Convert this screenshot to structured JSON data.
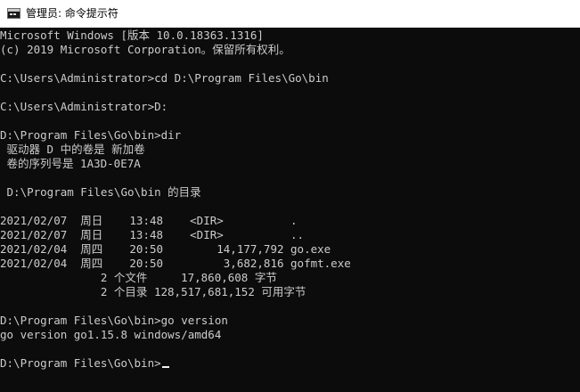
{
  "window": {
    "title": "管理员: 命令提示符",
    "icon": "cmd-console-icon"
  },
  "colors": {
    "background": "#0c0c0c",
    "text": "#cccccc",
    "titlebar": "#ffffff"
  },
  "console": {
    "lines": [
      "Microsoft Windows [版本 10.0.18363.1316]",
      "(c) 2019 Microsoft Corporation。保留所有权利。",
      "C:\\Users\\Administrator>cd D:\\Program Files\\Go\\bin",
      "C:\\Users\\Administrator>D:",
      "D:\\Program Files\\Go\\bin>dir",
      " 驱动器 D 中的卷是 新加卷",
      " 卷的序列号是 1A3D-0E7A",
      " D:\\Program Files\\Go\\bin 的目录",
      "2021/02/07  周日    13:48    <DIR>          .",
      "2021/02/07  周日    13:48    <DIR>          ..",
      "2021/02/04  周四    20:50        14,177,792 go.exe",
      "2021/02/04  周四    20:50         3,682,816 gofmt.exe",
      "               2 个文件     17,860,608 字节",
      "               2 个目录 128,517,681,152 可用字节",
      "D:\\Program Files\\Go\\bin>go version",
      "go version go1.15.8 windows/amd64",
      "D:\\Program Files\\Go\\bin>"
    ]
  }
}
